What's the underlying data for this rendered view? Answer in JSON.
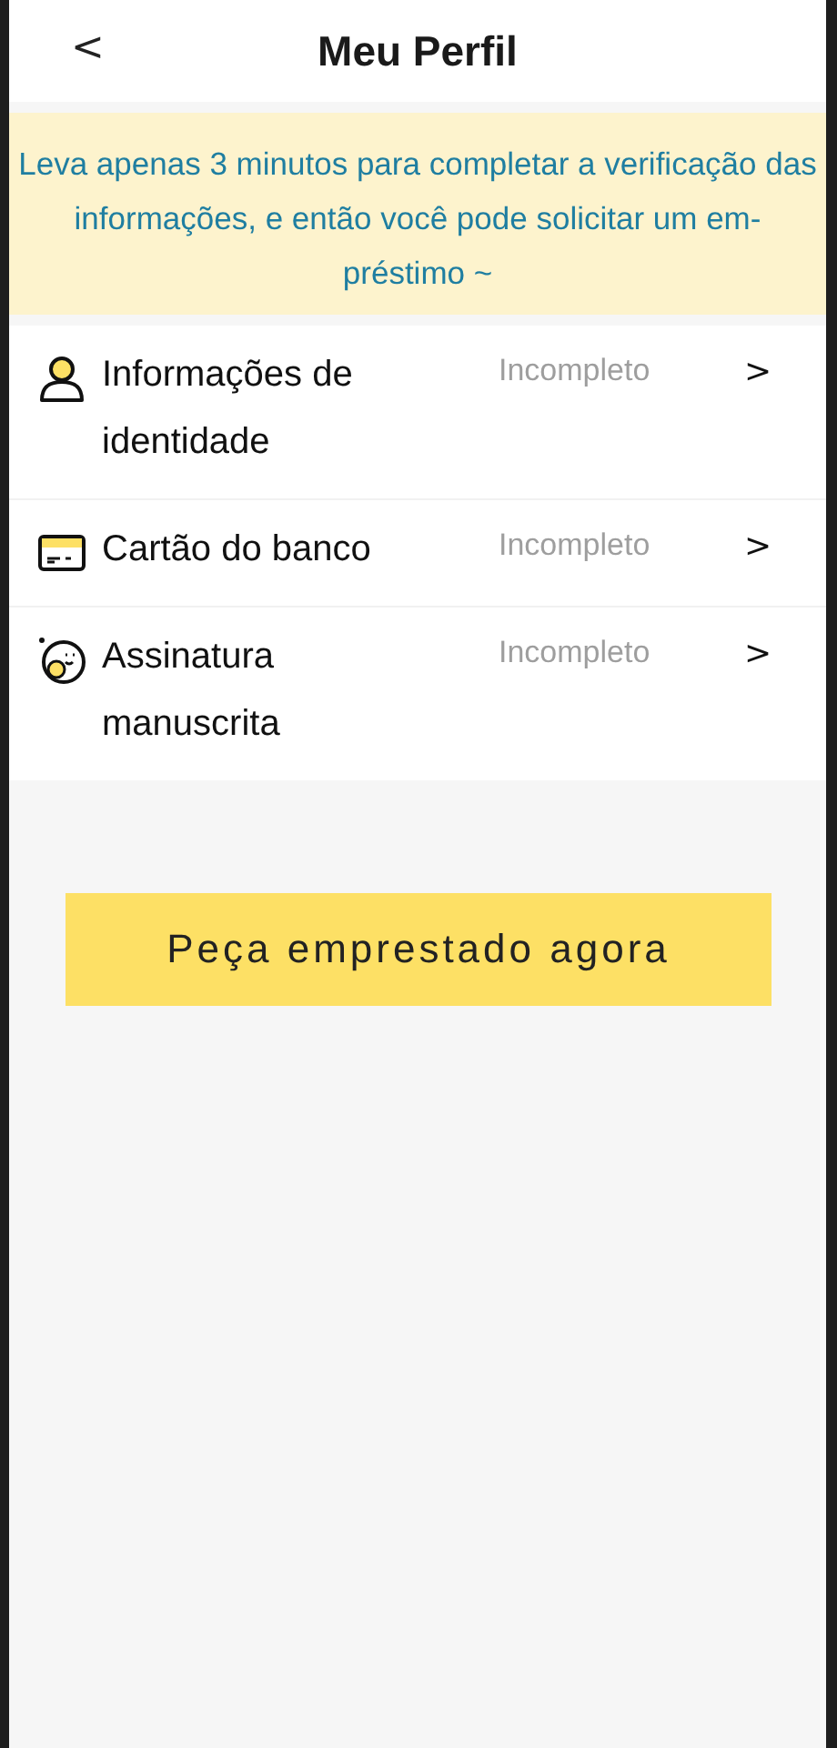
{
  "header": {
    "back": "<",
    "title": "Meu Perfil"
  },
  "notice": "Leva apenas 3 minutos para completar a verificação das informações, e então você pode solicitar um em-préstimo ~",
  "items": [
    {
      "kind": "person",
      "label": "Informações de identidade",
      "status": "Incompleto",
      "chevron": ">"
    },
    {
      "kind": "card",
      "label": "Cartão do banco",
      "status": "Incompleto",
      "chevron": ">"
    },
    {
      "kind": "signature",
      "label": "Assinatura manuscrita",
      "status": "Incompleto",
      "chevron": ">"
    }
  ],
  "button": "Peça emprestado agora"
}
